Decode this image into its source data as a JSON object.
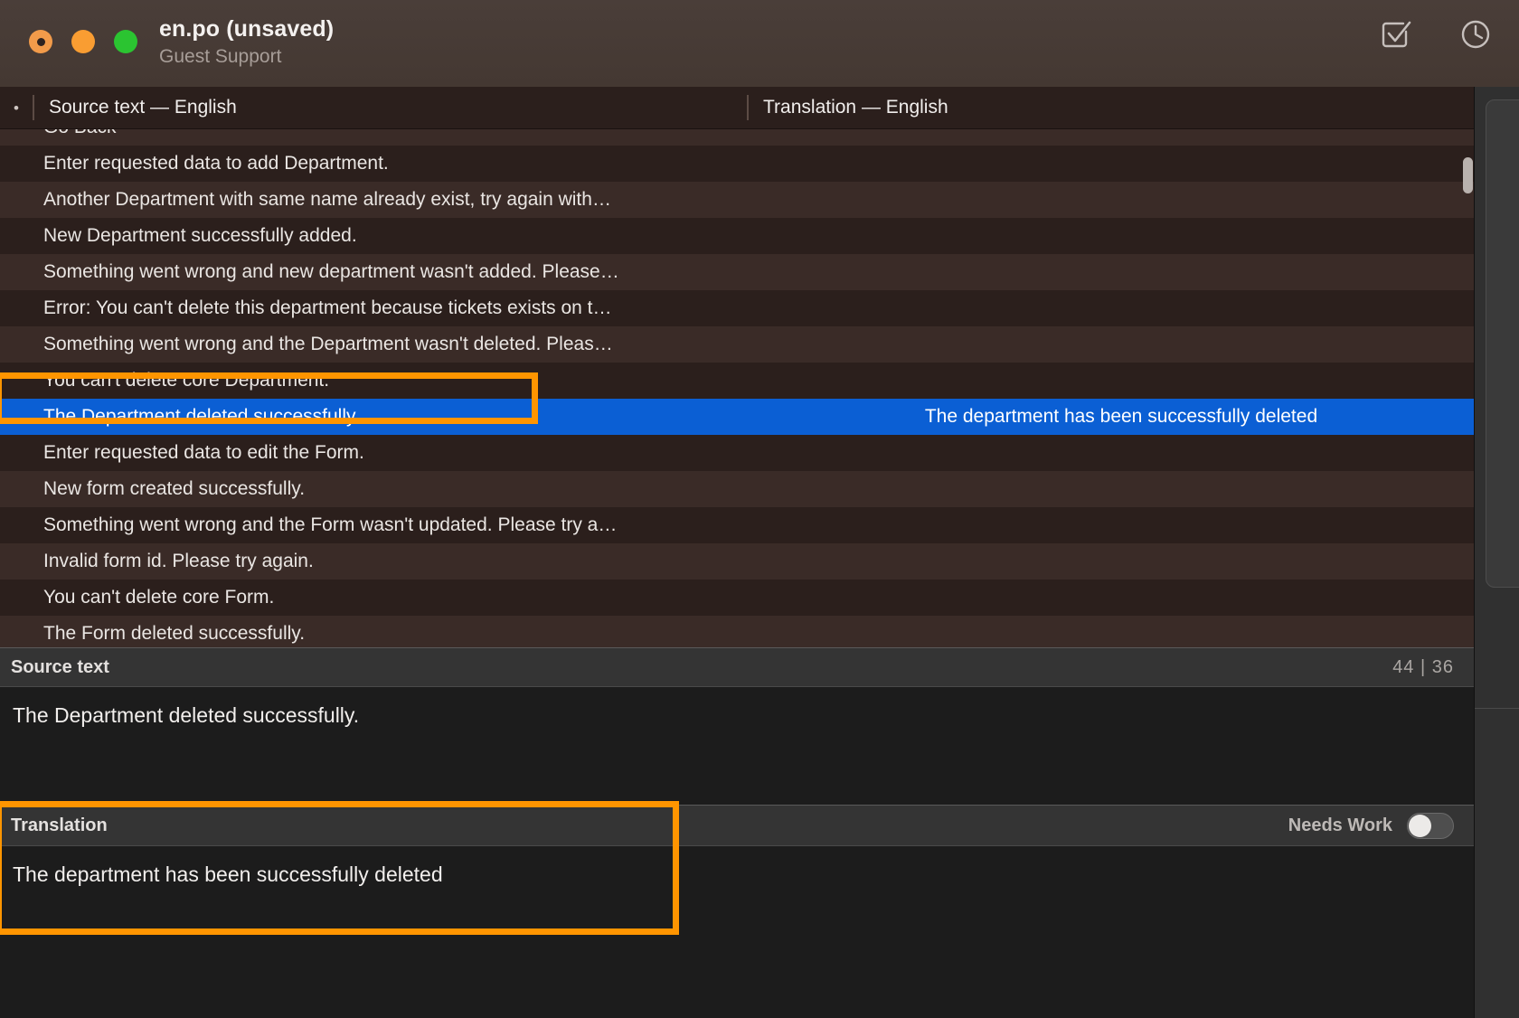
{
  "window": {
    "title": "en.po (unsaved)",
    "subtitle": "Guest Support",
    "traffic_lights": [
      "close",
      "minimize",
      "zoom"
    ],
    "toolbar": {
      "validate_icon": "checkbox-check-icon",
      "history_icon": "clock-history-icon"
    }
  },
  "colors": {
    "titlebar": "#463a35",
    "list_odd": "#2b1f1c",
    "list_even": "#3a2b27",
    "selection": "#0b5fd4",
    "annotation": "#ff9500",
    "panel_header": "#343434",
    "panel_body": "#1c1c1c",
    "sidebar": "#303030"
  },
  "columns": {
    "marker": "•",
    "source_header": "Source text — English",
    "translation_header": "Translation — English"
  },
  "rows": [
    {
      "source": "Go Back",
      "translation": "",
      "selected": false,
      "clipped_top": true
    },
    {
      "source": "Enter requested data to add Department.",
      "translation": "",
      "selected": false
    },
    {
      "source": "Another Department with same name already exist, try again with…",
      "translation": "",
      "selected": false
    },
    {
      "source": "New Department successfully added.",
      "translation": "",
      "selected": false
    },
    {
      "source": "Something went wrong and new department wasn't added. Please…",
      "translation": "",
      "selected": false
    },
    {
      "source": "Error: You can't delete this department because tickets exists on t…",
      "translation": "",
      "selected": false
    },
    {
      "source": "Something went wrong and the Department wasn't deleted. Pleas…",
      "translation": "",
      "selected": false
    },
    {
      "source": "You can't delete core Department.",
      "translation": "",
      "selected": false
    },
    {
      "source": "The Department deleted successfully.",
      "translation": "The department has been successfully deleted",
      "selected": true
    },
    {
      "source": "Enter requested data to edit the Form.",
      "translation": "",
      "selected": false
    },
    {
      "source": "New form created successfully.",
      "translation": "",
      "selected": false
    },
    {
      "source": "Something went wrong and the Form wasn't updated. Please try a…",
      "translation": "",
      "selected": false
    },
    {
      "source": "Invalid form id. Please try again.",
      "translation": "",
      "selected": false
    },
    {
      "source": "You can't delete core Form.",
      "translation": "",
      "selected": false
    },
    {
      "source": "The Form deleted successfully.",
      "translation": "",
      "selected": false,
      "clipped_bottom": true
    }
  ],
  "source_panel": {
    "label": "Source text",
    "counter": "44 | 36",
    "text": "The Department deleted successfully."
  },
  "translation_panel": {
    "label": "Translation",
    "needs_work_label": "Needs Work",
    "needs_work_on": false,
    "text": "The department has been successfully deleted"
  }
}
